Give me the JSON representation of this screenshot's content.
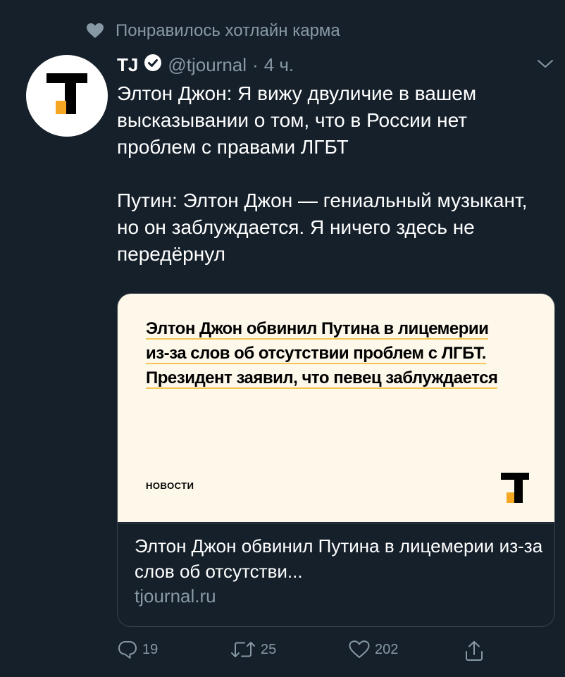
{
  "social_context": {
    "icon": "heart-icon",
    "text": "Понравилось хотлайн карма"
  },
  "tweet": {
    "author_name": "TJ",
    "verified_icon": "verified-badge-icon",
    "handle": "@tjournal",
    "separator": "·",
    "time": "4 ч.",
    "body": [
      "Элтон Джон: Я вижу двуличие в вашем высказывании о том, что в России нет проблем с правами ЛГБТ",
      "Путин: Элтон Джон — гениальный музыкант, но он заблуждается. Я ничего здесь не передёрнул"
    ]
  },
  "card": {
    "image_headline": "Элтон Джон обвинил Путина в лицемерии из-за слов об отсутствии проблем с ЛГБТ. Президент заявил, что певец заблуждается",
    "image_section": "НОВОСТИ",
    "title": "Элтон Джон обвинил Путина в лицемерии из-за слов об отсутстви...",
    "domain": "tjournal.ru"
  },
  "actions": {
    "reply_count": "19",
    "retweet_count": "25",
    "like_count": "202"
  },
  "colors": {
    "background": "#15202b",
    "secondary_text": "#8899a6",
    "card_image_bg": "#fdf8ea",
    "logo_accent": "#f5a623"
  }
}
